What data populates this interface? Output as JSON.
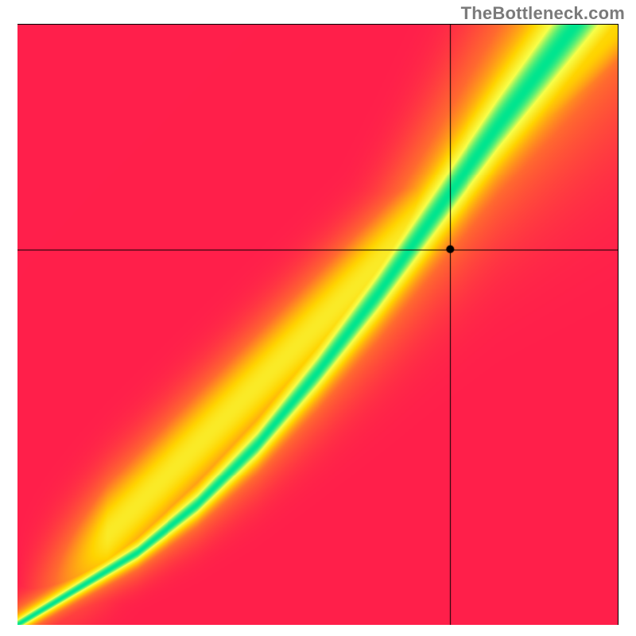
{
  "watermark": "TheBottleneck.com",
  "chart_data": {
    "type": "heatmap",
    "title": "",
    "xlabel": "",
    "ylabel": "",
    "xlim": [
      0,
      1
    ],
    "ylim": [
      0,
      1
    ],
    "grid": false,
    "legend": "none",
    "crosshair": {
      "x": 0.72,
      "y": 0.625
    },
    "marker": {
      "x": 0.72,
      "y": 0.625,
      "radius": 5
    },
    "green_ridge": {
      "description": "central high-compatibility band (green) from bottom-left to upper-right",
      "points": [
        {
          "x": 0.0,
          "y": 0.0
        },
        {
          "x": 0.1,
          "y": 0.06
        },
        {
          "x": 0.2,
          "y": 0.12
        },
        {
          "x": 0.3,
          "y": 0.2
        },
        {
          "x": 0.4,
          "y": 0.3
        },
        {
          "x": 0.5,
          "y": 0.42
        },
        {
          "x": 0.6,
          "y": 0.55
        },
        {
          "x": 0.7,
          "y": 0.69
        },
        {
          "x": 0.8,
          "y": 0.83
        },
        {
          "x": 0.9,
          "y": 0.96
        }
      ],
      "half_width": [
        0.01,
        0.012,
        0.015,
        0.02,
        0.026,
        0.033,
        0.041,
        0.05,
        0.06,
        0.072
      ]
    },
    "secondary_ridge": {
      "description": "secondary light-yellow diagonal near main diagonal",
      "points": [
        {
          "x": 0.0,
          "y": 0.0
        },
        {
          "x": 1.0,
          "y": 1.0
        }
      ],
      "half_width": 0.04
    },
    "color_stops": {
      "score_0": "#ff1f4b",
      "score_low": "#ff6a2f",
      "score_mid": "#ffd400",
      "score_hi_yellow": "#f7ff4a",
      "score_peak": "#00e58f"
    }
  }
}
